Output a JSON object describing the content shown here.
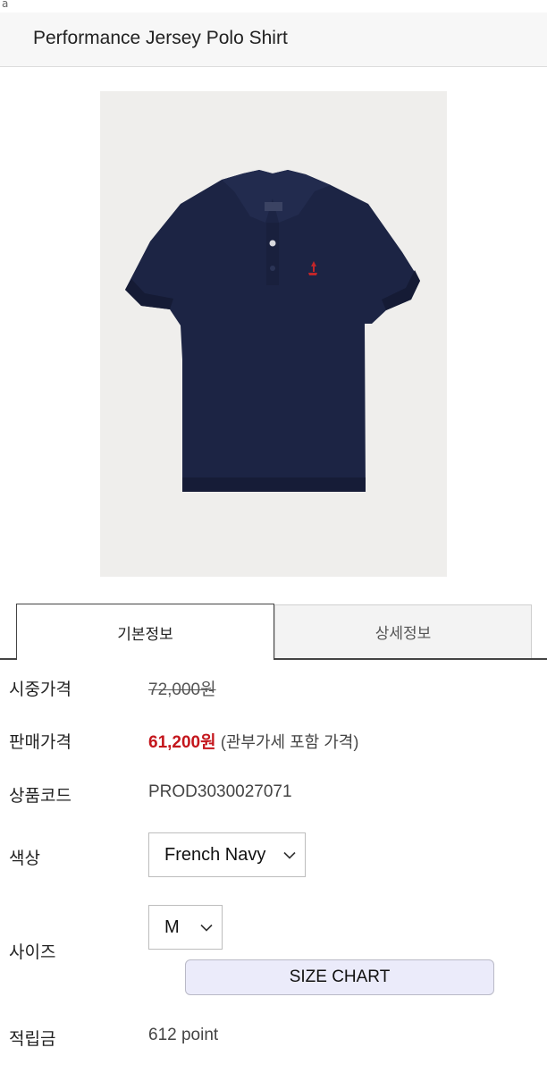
{
  "corner_mark": "a",
  "header": {
    "title": "Performance Jersey Polo Shirt"
  },
  "product_image": {
    "icon": "polo-shirt-photo",
    "shirt_color": "#1c2444",
    "logo_color": "#c0262a",
    "background": "#efeeec"
  },
  "tabs": [
    {
      "label": "기본정보",
      "active": true
    },
    {
      "label": "상세정보",
      "active": false
    }
  ],
  "info": {
    "list_price_label": "시중가격",
    "list_price": "72,000원",
    "sale_price_label": "판매가격",
    "sale_price": "61,200원",
    "sale_price_note": "(관부가세 포함 가격)",
    "code_label": "상품코드",
    "code": "PROD3030027071",
    "color_label": "색상",
    "color_selected": "French Navy",
    "size_label": "사이즈",
    "size_selected": "M",
    "size_chart_label": "SIZE CHART",
    "points_label": "적립금",
    "points": "612 point"
  },
  "colors": {
    "sale_price": "#c4161c",
    "size_chart_bg": "#ebebfa"
  }
}
